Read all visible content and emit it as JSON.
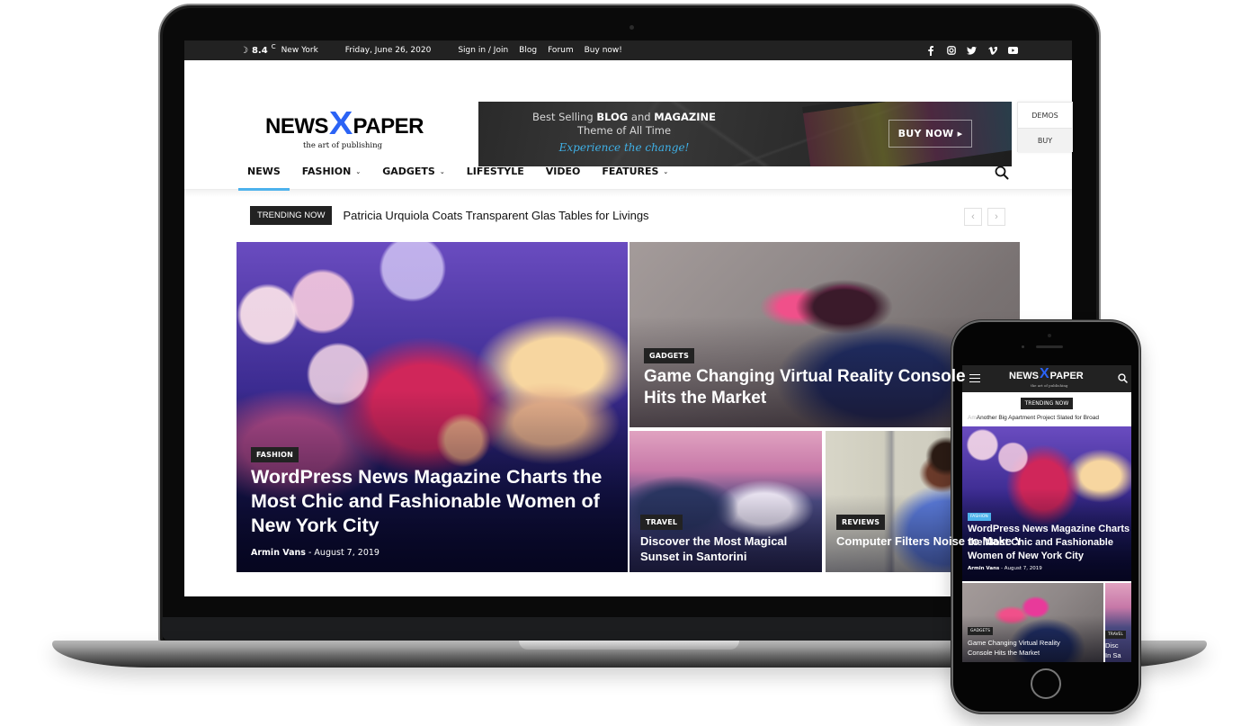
{
  "topbar": {
    "weather_icon": "moon-icon",
    "temperature": "8.4",
    "temperature_unit": "C",
    "city": "New York",
    "date": "Friday, June 26, 2020",
    "links": [
      "Sign in / Join",
      "Blog",
      "Forum",
      "Buy now!"
    ],
    "social_icons": [
      "facebook-icon",
      "instagram-icon",
      "twitter-icon",
      "vimeo-icon",
      "youtube-icon"
    ]
  },
  "logo": {
    "part1": "NEWS",
    "part2": "X",
    "part3": "PAPER",
    "tagline": "the art of publishing",
    "accent_color": "#2b63f5"
  },
  "ad_banner": {
    "line1_pre": "Best Selling ",
    "line1_bold1": "BLOG",
    "line1_mid": " and ",
    "line1_bold2": "MAGAZINE",
    "line2": "Theme of All Time",
    "line3": "Experience the change!",
    "cta": "BUY NOW ▸"
  },
  "side_panel": {
    "demos": "DEMOS",
    "buy": "BUY"
  },
  "nav": {
    "items": [
      {
        "label": "NEWS",
        "active": true,
        "dropdown": false
      },
      {
        "label": "FASHION",
        "active": false,
        "dropdown": true
      },
      {
        "label": "GADGETS",
        "active": false,
        "dropdown": true
      },
      {
        "label": "LIFESTYLE",
        "active": false,
        "dropdown": false
      },
      {
        "label": "VIDEO",
        "active": false,
        "dropdown": false
      },
      {
        "label": "FEATURES",
        "active": false,
        "dropdown": true
      }
    ],
    "active_color": "#4db2ec",
    "search_icon": "search-icon"
  },
  "trending": {
    "label": "TRENDING NOW",
    "title": "Patricia Urquiola Coats Transparent Glas Tables for Livings",
    "prev": "‹",
    "next": "›"
  },
  "articles": [
    {
      "category": "FASHION",
      "title": "WordPress News Magazine Charts the Most Chic and Fashionable Women of New York City",
      "author": "Armin Vans",
      "date": "August 7, 2019"
    },
    {
      "category": "GADGETS",
      "title": "Game Changing Virtual Reality Console Hits the Market"
    },
    {
      "category": "TRAVEL",
      "title": "Discover the Most Magical Sunset in Santorini"
    },
    {
      "category": "REVIEWS",
      "title": "Computer Filters Noise to Make You a Better Listener"
    }
  ],
  "phone": {
    "logo_part1": "NEWS",
    "logo_part2": "X",
    "logo_part3": "PAPER",
    "tagline": "the art of publishing",
    "trending_label": "TRENDING NOW",
    "trending_fade": "Am",
    "trending_title": "Another Big Apartment Project Slated for Broad",
    "main_category": "FASHION",
    "main_title_lines": [
      "WordPress News Magazine Charts",
      "the Most Chic and Fashionable",
      "Women of New York City"
    ],
    "main_author": "Armin Vans",
    "main_date": "August 7, 2019",
    "second_category": "GADGETS",
    "second_title_lines": [
      "Game Changing Virtual Reality",
      "Console Hits the Market"
    ],
    "third_category": "TRAVEL",
    "third_title_lines": [
      "Disc",
      "In Sa"
    ],
    "category_color": "#4db2ec"
  }
}
